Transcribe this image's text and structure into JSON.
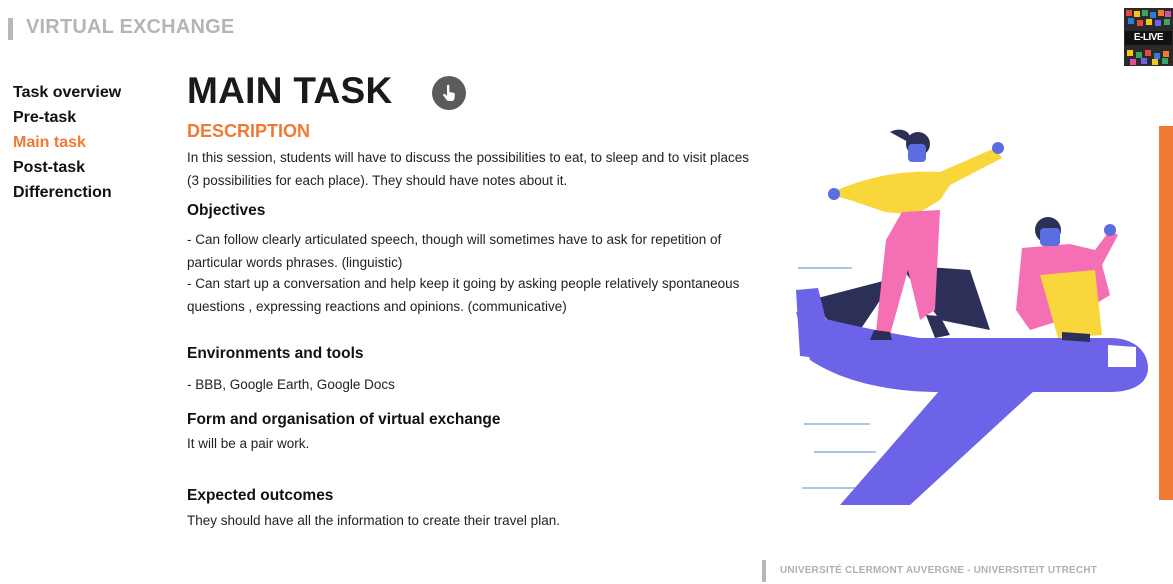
{
  "header": {
    "title": "VIRTUAL EXCHANGE"
  },
  "logo": {
    "text": "E-LIVE"
  },
  "nav": {
    "items": [
      {
        "label": "Task overview",
        "active": false
      },
      {
        "label": "Pre-task",
        "active": false
      },
      {
        "label": "Main task",
        "active": true
      },
      {
        "label": "Post-task",
        "active": false
      },
      {
        "label": "Differenction",
        "active": false
      }
    ]
  },
  "main": {
    "title": "MAIN TASK",
    "action_icon": "hand-pointer-icon",
    "description_heading": "DESCRIPTION",
    "description_lines": [
      "In this session, students will have to discuss the possibilities to eat, to sleep and to visit places",
      "(3 possibilities for each place). They should have notes about it."
    ],
    "objectives_heading": "Objectives",
    "objectives_lines": [
      "- Can follow clearly articulated speech, though will sometimes have to ask for repetition of",
      "particular words phrases. (linguistic)",
      "- Can start up a conversation and help keep it going by asking people relatively spontaneous",
      "questions , expressing reactions and opinions. (communicative)"
    ],
    "environments_heading": "Environments and tools",
    "environments_text": "- BBB, Google Earth, Google Docs",
    "form_heading": "Form and organisation of virtual exchange",
    "form_text": "It will be a pair work.",
    "outcomes_heading": "Expected outcomes",
    "outcomes_text": "They should have all the information to create their travel plan."
  },
  "footer": {
    "text": "UNIVERSITÉ CLERMONT AUVERGNE - UNIVERSITEIT UTRECHT"
  },
  "colors": {
    "accent": "#ef7a33",
    "plane": "#6c63e8",
    "muted": "#b5b5b5"
  }
}
